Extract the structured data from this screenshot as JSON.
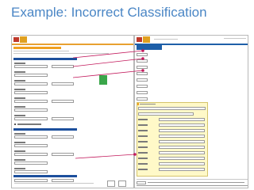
{
  "slide": {
    "title": "Example: Incorrect Classification"
  },
  "colors": {
    "title": "#4a86c5",
    "section_header": "#1c4f9c",
    "highlight_orange": "#f0a020",
    "arrow": "#c2185b"
  }
}
